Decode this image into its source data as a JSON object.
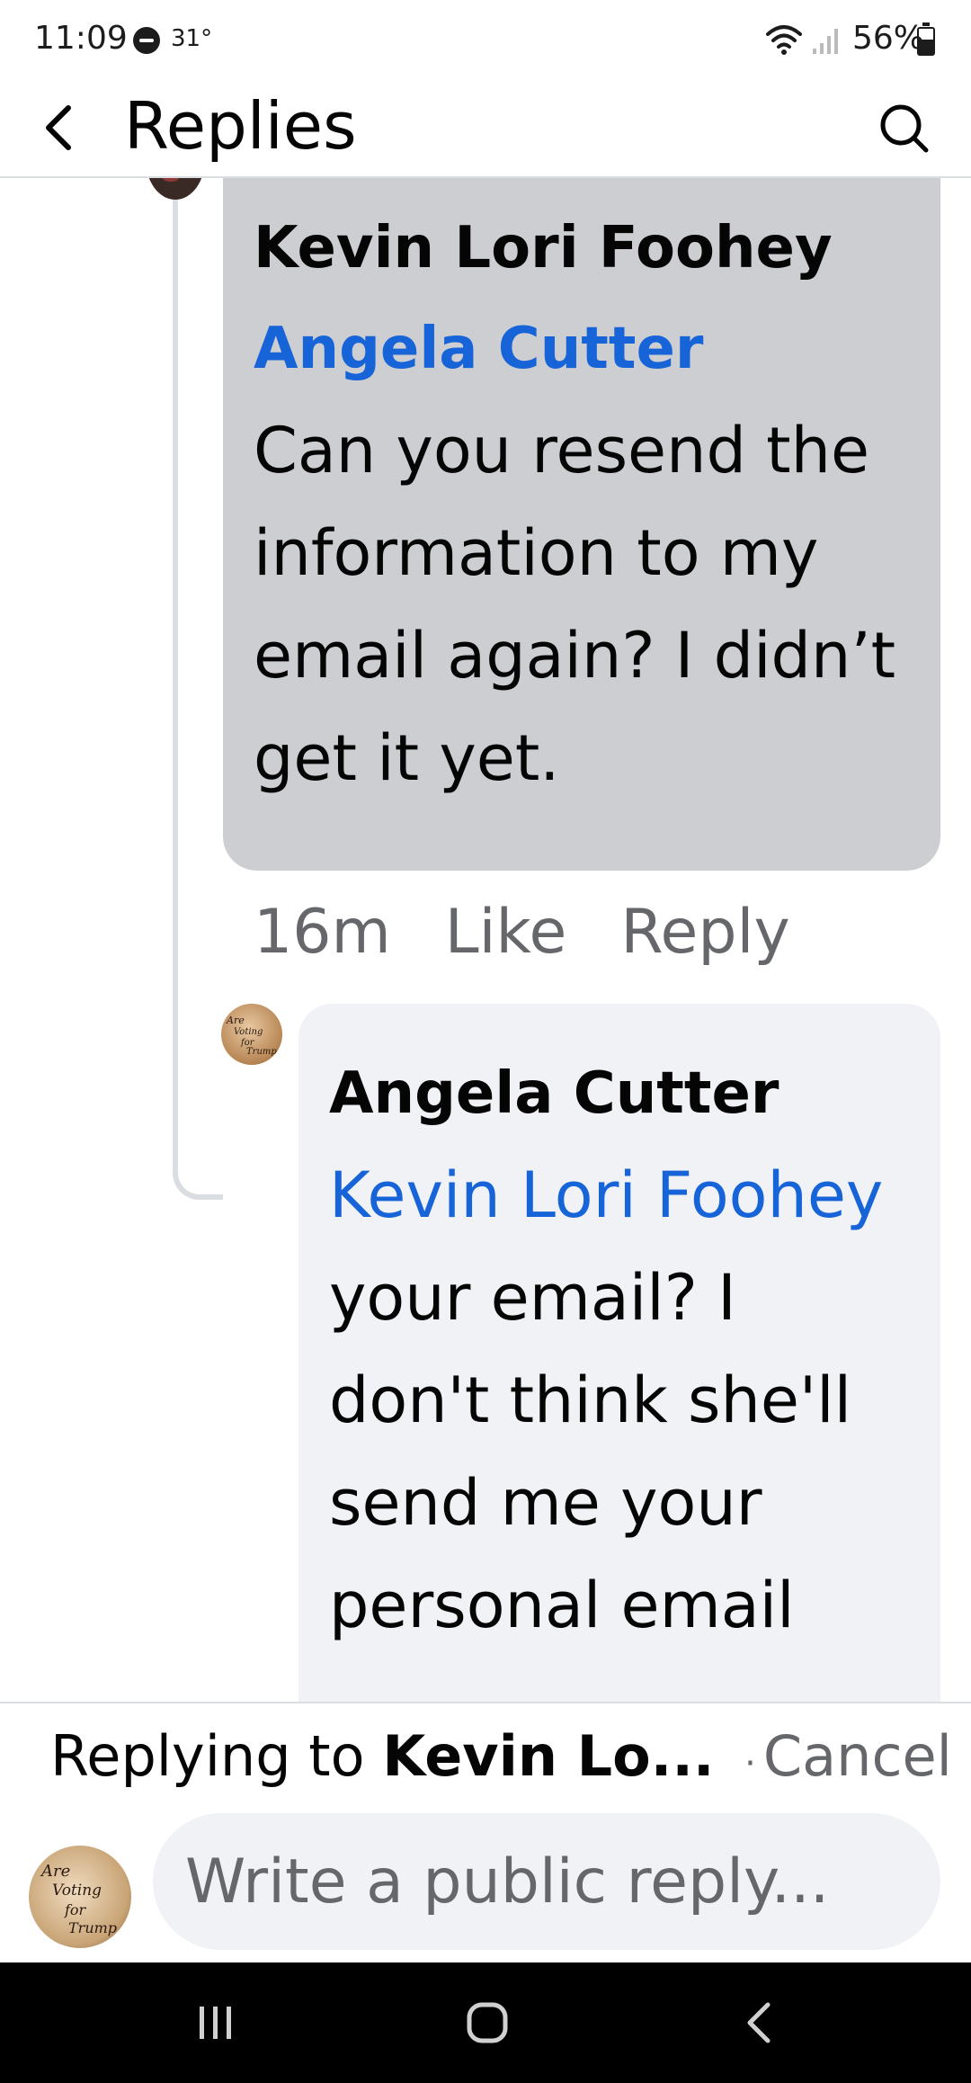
{
  "status_bar": {
    "time": "11:09",
    "temperature": "31°",
    "battery": "56%",
    "battery_level": 0.56
  },
  "header": {
    "title": "Replies",
    "back_icon": "chevron-left-icon",
    "search_icon": "search-icon"
  },
  "comments": [
    {
      "author": "Kevin Lori Foohey",
      "mention": "Angela Cutter",
      "text": "Can you resend the information to my email again? I didn’t get it yet.",
      "time": "16m",
      "like_label": "Like",
      "reply_label": "Reply"
    },
    {
      "author": "Angela Cutter",
      "mention": "Kevin Lori Foohey",
      "text": "your email? I don't think she'll send me your personal email"
    }
  ],
  "composer": {
    "replying_prefix": "Replying to",
    "replying_name": "Kevin Lo...",
    "separator": "·",
    "cancel_label": "Cancel",
    "placeholder": "Write a public reply...",
    "avatar_text": [
      "Are",
      "Voting",
      "for",
      "Trump"
    ]
  },
  "nav": {
    "recents_icon": "recents-icon",
    "home_icon": "home-icon",
    "back_icon": "back-icon"
  },
  "colors": {
    "mention": "#1764d8",
    "bubble_self": "#ccced1",
    "bubble_other": "#f0f2f5",
    "secondary_text": "#65676b"
  }
}
